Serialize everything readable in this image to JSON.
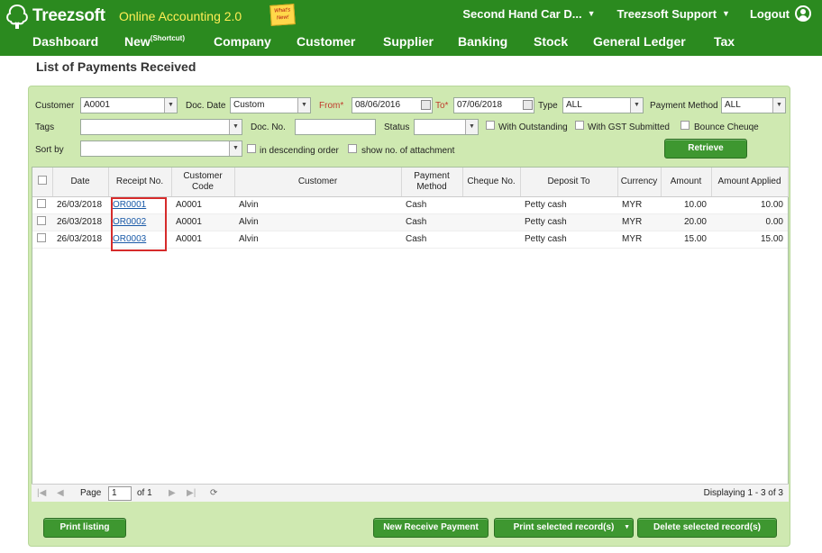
{
  "app": {
    "brand": "Treezsoft",
    "product": "Online Accounting 2.0",
    "sticky_note": "What's New!"
  },
  "topnav": {
    "company": "Second Hand Car D...",
    "support": "Treezsoft Support",
    "logout": "Logout"
  },
  "mainnav": {
    "items": [
      "Dashboard",
      "New",
      "Company",
      "Customer",
      "Supplier",
      "Banking",
      "Stock",
      "General Ledger",
      "Tax"
    ],
    "new_sup": "(Shortcut)"
  },
  "page": {
    "title": "List of Payments Received"
  },
  "filters": {
    "customer_label": "Customer",
    "customer_value": "A0001",
    "docdate_label": "Doc. Date",
    "docdate_value": "Custom",
    "from_label": "From*",
    "from_value": "08/06/2016",
    "to_label": "To*",
    "to_value": "07/06/2018",
    "type_label": "Type",
    "type_value": "ALL",
    "paymethod_label": "Payment Method",
    "paymethod_value": "ALL",
    "tags_label": "Tags",
    "tags_value": "",
    "docno_label": "Doc. No.",
    "docno_value": "",
    "status_label": "Status",
    "status_value": "",
    "with_outstanding": "With Outstanding",
    "with_gst": "With GST Submitted",
    "bounce_cheque": "Bounce Cheuqe",
    "sortby_label": "Sort by",
    "sortby_value": "",
    "desc_order": "in descending order",
    "show_attach": "show no. of attachment",
    "retrieve": "Retrieve"
  },
  "table": {
    "headers": [
      "Date",
      "Receipt No.",
      "Customer Code",
      "Customer",
      "Payment Method",
      "Cheque No.",
      "Deposit To",
      "Currency",
      "Amount",
      "Amount Applied"
    ],
    "rows": [
      {
        "date": "26/03/2018",
        "receipt": "OR0001",
        "code": "A0001",
        "customer": "Alvin",
        "method": "Cash",
        "cheque": "",
        "deposit": "Petty cash",
        "currency": "MYR",
        "amount": "10.00",
        "applied": "10.00"
      },
      {
        "date": "26/03/2018",
        "receipt": "OR0002",
        "code": "A0001",
        "customer": "Alvin",
        "method": "Cash",
        "cheque": "",
        "deposit": "Petty cash",
        "currency": "MYR",
        "amount": "20.00",
        "applied": "0.00"
      },
      {
        "date": "26/03/2018",
        "receipt": "OR0003",
        "code": "A0001",
        "customer": "Alvin",
        "method": "Cash",
        "cheque": "",
        "deposit": "Petty cash",
        "currency": "MYR",
        "amount": "15.00",
        "applied": "15.00"
      }
    ]
  },
  "pager": {
    "page_label": "Page",
    "page_value": "1",
    "of_label": "of 1",
    "displaying": "Displaying 1 - 3 of 3"
  },
  "actions": {
    "print_listing": "Print listing",
    "new_receive": "New Receive Payment",
    "print_selected": "Print selected record(s)",
    "delete_selected": "Delete selected record(s)"
  },
  "colors": {
    "green": "#2b8a1f",
    "panel": "#cfe9b1",
    "button": "#3e9730",
    "highlight": "#d62b2b"
  }
}
